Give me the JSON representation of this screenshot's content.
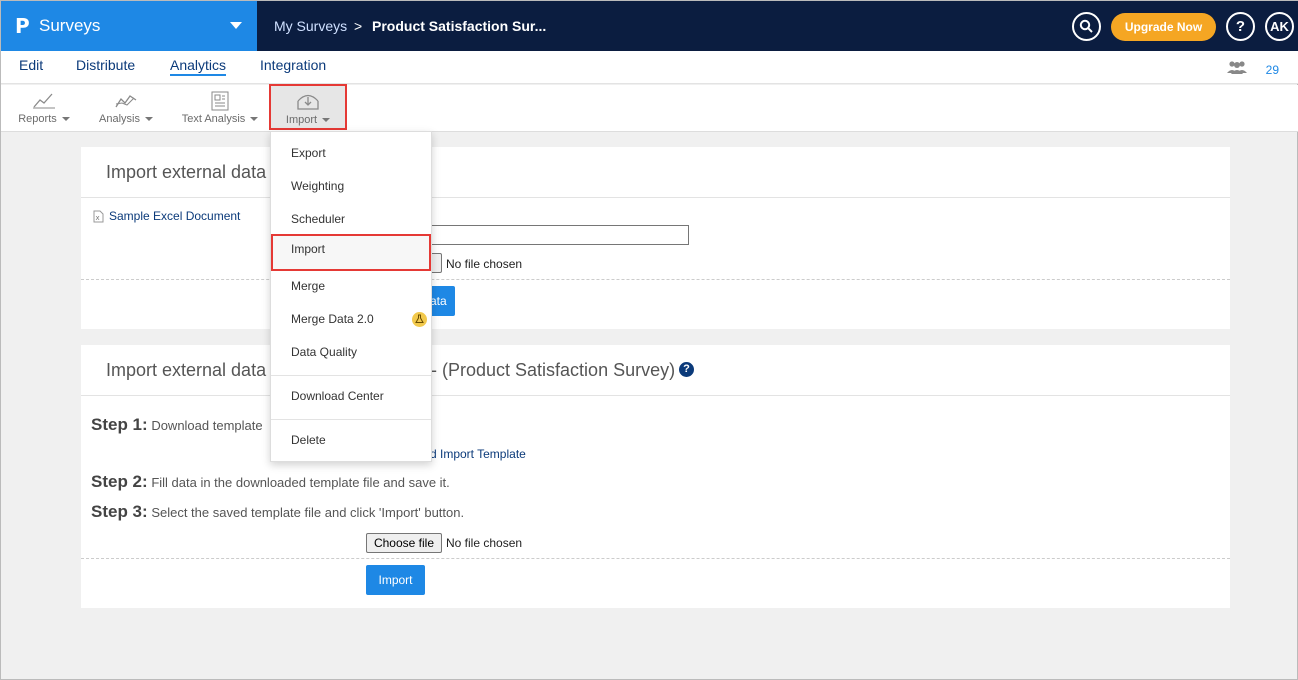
{
  "header": {
    "logo": "P",
    "app_name": "Surveys",
    "breadcrumb": [
      "My Surveys",
      "Product Satisfaction Sur..."
    ],
    "breadcrumb_separator": ">",
    "search_icon": "search-icon",
    "upgrade_label": "Upgrade Now",
    "help_label": "?",
    "avatar_initials": "AK"
  },
  "tabs": [
    "Edit",
    "Distribute",
    "Analytics",
    "Integration"
  ],
  "active_tab": "Analytics",
  "participants_count": "29",
  "toolbar": {
    "reports": "Reports",
    "analysis": "Analysis",
    "text_analysis": "Text Analysis",
    "import": "Import"
  },
  "card1": {
    "title": "Import external data",
    "sample_link": "Sample Excel Document",
    "no_file": "No file chosen",
    "button_fragment": "ata"
  },
  "card2": {
    "title_left": "Import external data",
    "title_right": "- (Product Satisfaction Survey)",
    "step1_label": "Step 1:",
    "step1_text": "Download template",
    "download_link": "d Import Template",
    "step2_label": "Step 2:",
    "step2_text": "Fill data in the downloaded template file and save it.",
    "step3_label": "Step 3:",
    "step3_text": "Select the saved template file and click 'Import' button.",
    "choose_file": "Choose file",
    "no_file": "No file chosen",
    "import_button": "Import"
  },
  "menu": {
    "items": [
      "Export",
      "Weighting",
      "Scheduler",
      "Import",
      "Merge",
      "Merge Data 2.0",
      "Data Quality",
      "Download Center",
      "Delete"
    ],
    "highlighted": "Import"
  },
  "colors": {
    "topbar": "#0b1d40",
    "brand": "#1e88e5",
    "upgrade": "#f5a623",
    "highlight_border": "#e53935",
    "link": "#0b3a7a"
  }
}
